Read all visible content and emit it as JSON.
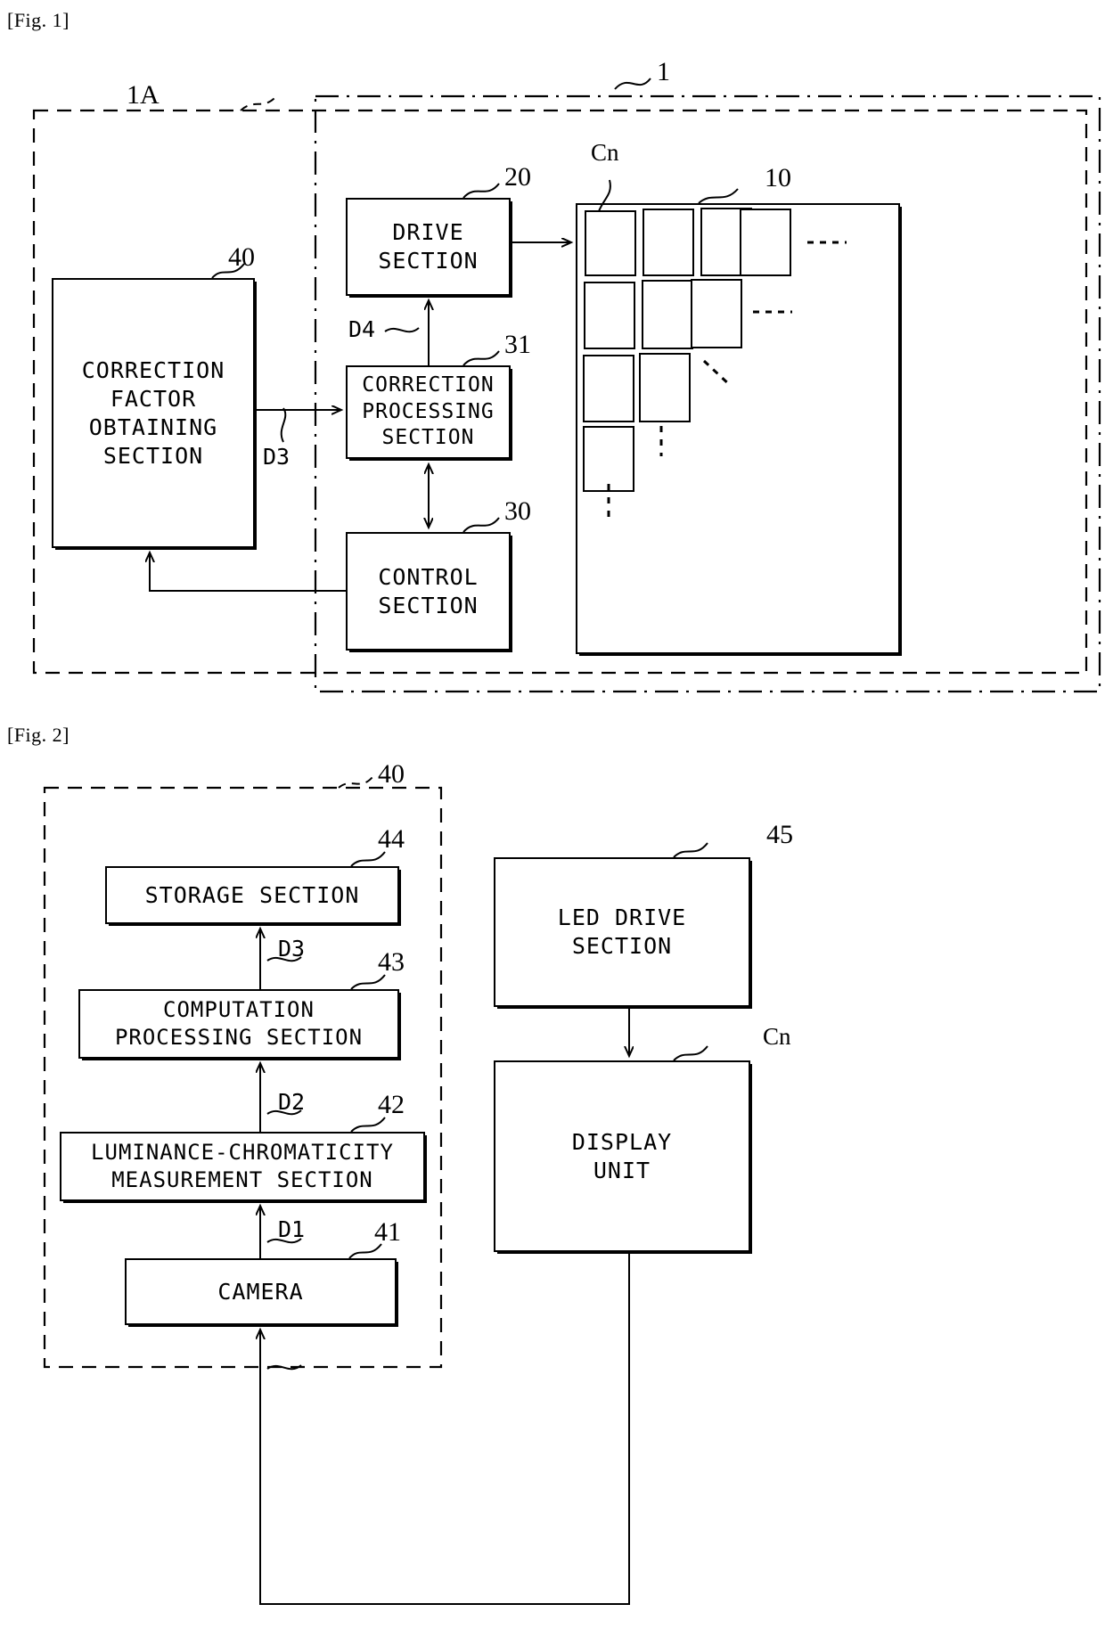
{
  "figures": [
    {
      "caption": "[Fig. 1]",
      "ref_labels": {
        "system": "1",
        "calibration_system": "1A",
        "display_panel": "10",
        "drive_section": "20",
        "control_section": "30",
        "correction_processing_section": "31",
        "correction_factor_obtaining_section": "40",
        "cabinet": "Cn"
      },
      "boxes": {
        "drive_section": "DRIVE\nSECTION",
        "correction_processing_section": "CORRECTION\nPROCESSING\nSECTION",
        "control_section": "CONTROL\nSECTION",
        "correction_factor_obtaining_section": "CORRECTION\nFACTOR\nOBTAINING\nSECTION"
      },
      "signals": {
        "d3": "D3",
        "d4": "D4"
      },
      "panel": {
        "rows": [
          4,
          3,
          2,
          1
        ],
        "ellipsis_row1": "......",
        "ellipsis_row2": "- - - -",
        "ellipsis_row3_diagonal": "diagonal-dots",
        "ellipsis_row4_vertical": "vertical-dots",
        "ellipsis_col_vertical": "vertical-dots"
      }
    },
    {
      "caption": "[Fig. 2]",
      "ref_labels": {
        "correction_factor_obtaining_section": "40",
        "camera": "41",
        "luminance_chromaticity_measurement_section": "42",
        "computation_processing_section": "43",
        "storage_section": "44",
        "led_drive_section": "45",
        "display_unit": "Cn"
      },
      "boxes": {
        "storage_section": "STORAGE SECTION",
        "computation_processing_section": "COMPUTATION\nPROCESSING SECTION",
        "luminance_chromaticity_measurement_section": "LUMINANCE-CHROMATICITY\nMEASUREMENT SECTION",
        "camera": "CAMERA",
        "led_drive_section": "LED DRIVE\nSECTION",
        "display_unit": "DISPLAY\nUNIT"
      },
      "signals": {
        "d1": "D1",
        "d2": "D2",
        "d3": "D3"
      }
    }
  ]
}
